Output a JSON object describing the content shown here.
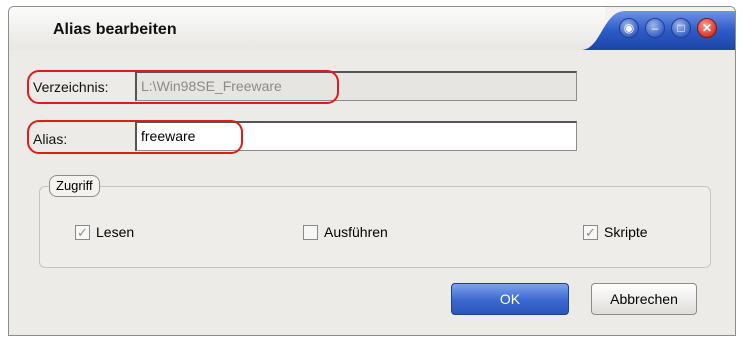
{
  "window": {
    "title": "Alias bearbeiten"
  },
  "titlebar_buttons": {
    "help_glyph": "◉",
    "minimize_glyph": "–",
    "maximize_glyph": "□",
    "close_glyph": "✕"
  },
  "form": {
    "directory_label": "Verzeichnis:",
    "directory_value": "L:\\Win98SE_Freeware",
    "alias_label": "Alias:",
    "alias_value": "freeware"
  },
  "access_group": {
    "title": "Zugriff",
    "options": [
      {
        "label": "Lesen",
        "checked": true
      },
      {
        "label": "Ausführen",
        "checked": false
      },
      {
        "label": "Skripte",
        "checked": true
      }
    ]
  },
  "buttons": {
    "ok_label": "OK",
    "cancel_label": "Abbrechen"
  },
  "colors": {
    "highlight_ring": "#e01b1b",
    "ok_button": "#3a67d0",
    "titlebar_blue": "#2a55c0"
  }
}
